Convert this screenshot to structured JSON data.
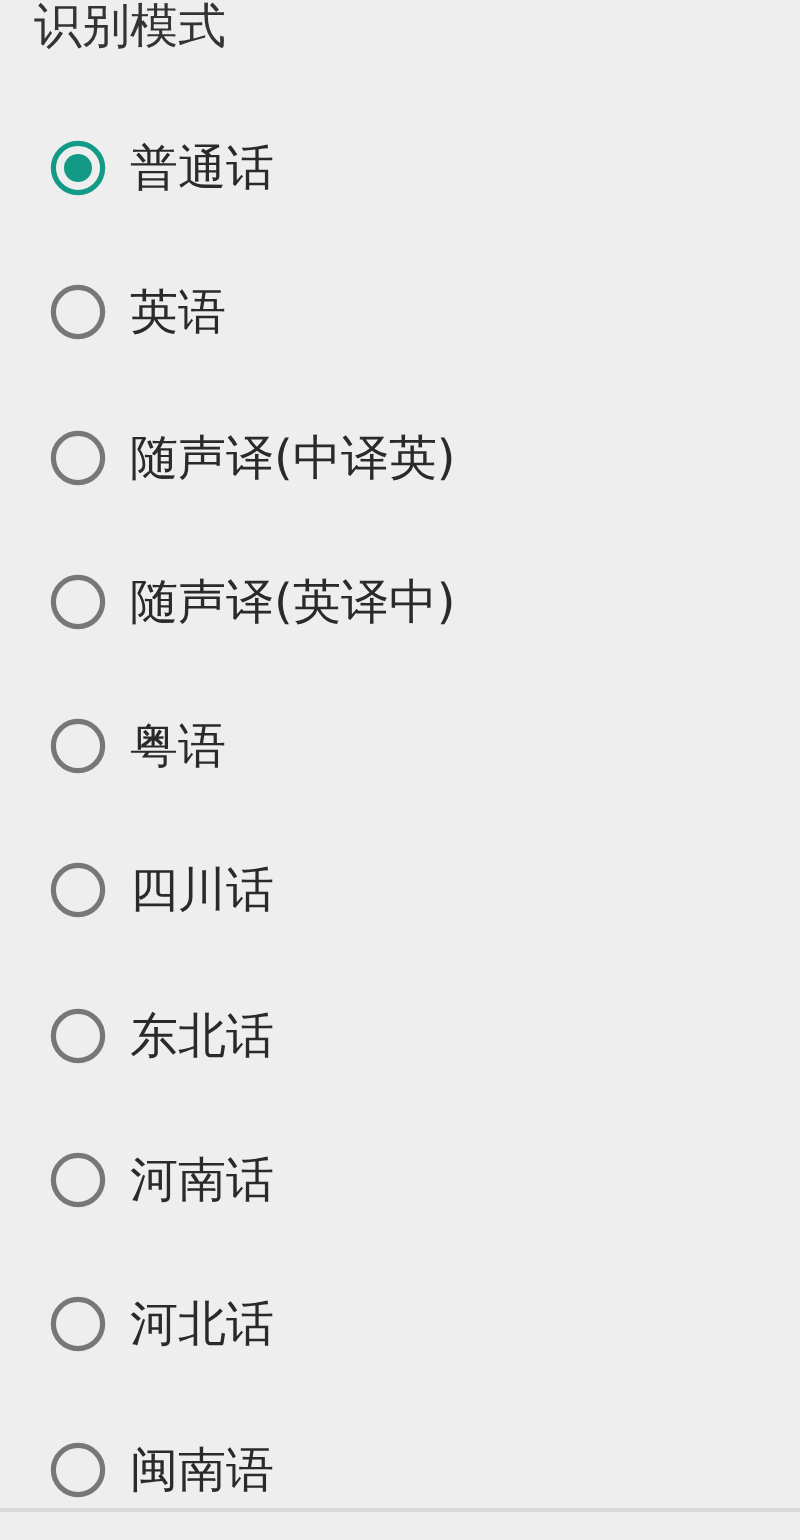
{
  "dialog": {
    "title": "识别模式"
  },
  "options": [
    {
      "label": "普通话",
      "selected": true
    },
    {
      "label": "英语",
      "selected": false
    },
    {
      "label": "随声译(中译英)",
      "selected": false
    },
    {
      "label": "随声译(英译中)",
      "selected": false
    },
    {
      "label": "粤语",
      "selected": false
    },
    {
      "label": "四川话",
      "selected": false
    },
    {
      "label": "东北话",
      "selected": false
    },
    {
      "label": "河南话",
      "selected": false
    },
    {
      "label": "河北话",
      "selected": false
    },
    {
      "label": "闽南语",
      "selected": false
    }
  ]
}
